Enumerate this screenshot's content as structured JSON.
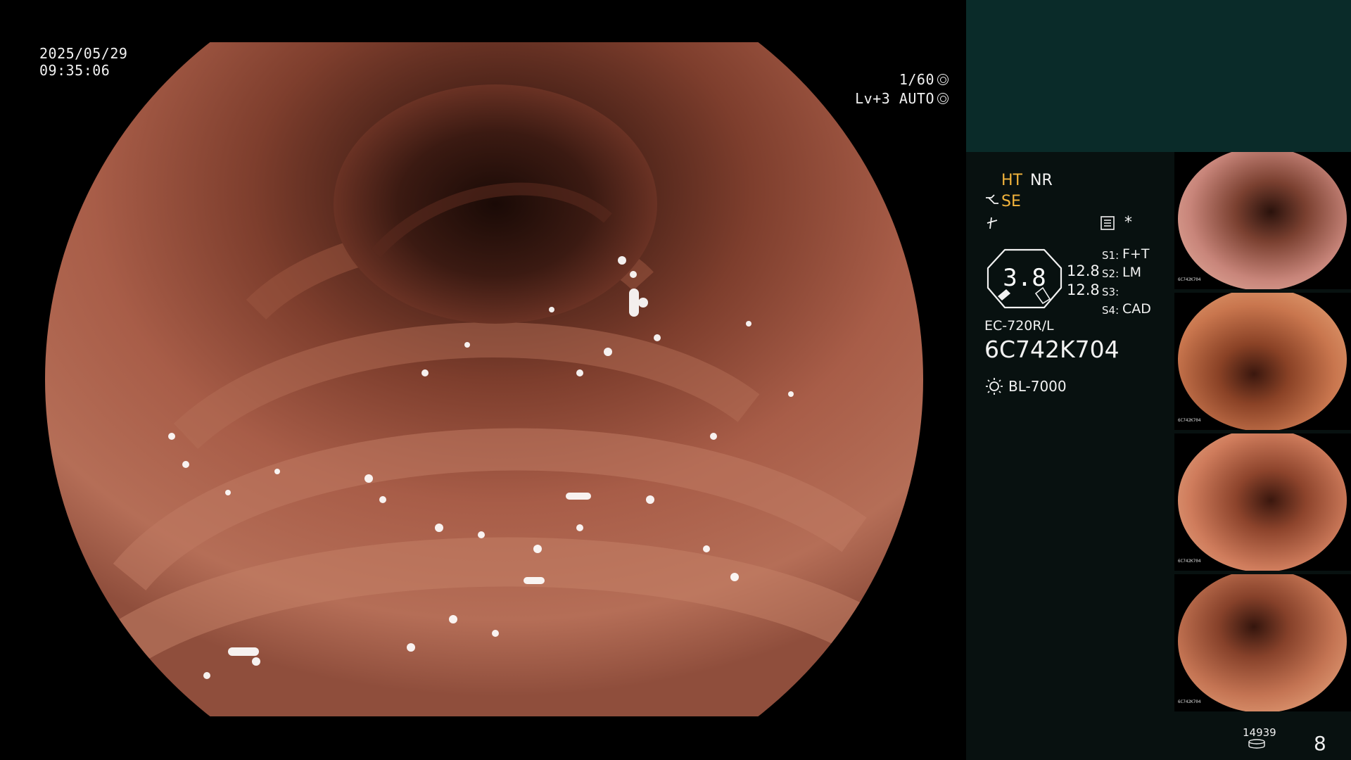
{
  "overlay": {
    "date": "2025/05/29",
    "time": "09:35:06",
    "shutter": "1/60",
    "level": "Lv+3 AUTO"
  },
  "panel": {
    "mode_ht": "HT",
    "mode_nr": "NR",
    "mode_se": "SE",
    "star": "*",
    "gauge_value": "3.8",
    "gauge_right_top": "12.8",
    "gauge_right_bottom": "12.8",
    "s1_label": "S1:",
    "s1_value": "F+T",
    "s2_label": "S2:",
    "s2_value": "LM",
    "s3_label": "S3:",
    "s3_value": "",
    "s4_label": "S4:",
    "s4_value": "CAD",
    "scope_model": "EC-720R/L",
    "scope_serial": "6C742K704",
    "light_source": "BL-7000"
  },
  "thumbnails": [
    {
      "id_text": "6C742K704",
      "tint": "#c8857a"
    },
    {
      "id_text": "6C742K704",
      "tint": "#c9764e"
    },
    {
      "id_text": "6C742K704",
      "tint": "#cf7c5c"
    },
    {
      "id_text": "6C742K704",
      "tint": "#c47453"
    }
  ],
  "footer": {
    "image_count": "14939",
    "page_number": "8"
  },
  "colors": {
    "accent_amber": "#f2b43c",
    "panel_teal": "#0a2b29",
    "panel_dark": "#081110",
    "mucosa": "#a9614e"
  },
  "icons": [
    "fan-icon",
    "gear-icon",
    "pen-icon",
    "lightning-icon",
    "report-icon",
    "lamp-icon",
    "disk-icon"
  ]
}
